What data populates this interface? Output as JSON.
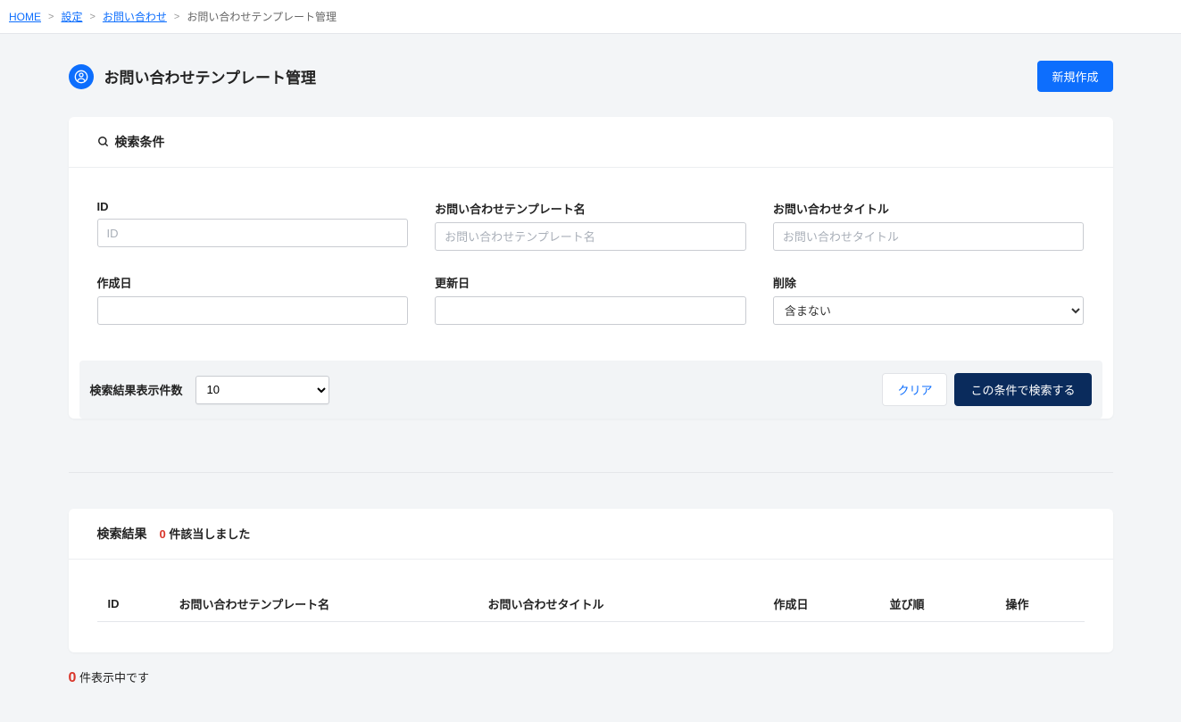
{
  "breadcrumb": {
    "items": [
      {
        "label": "HOME",
        "link": true
      },
      {
        "label": "設定",
        "link": true
      },
      {
        "label": "お問い合わせ",
        "link": true
      },
      {
        "label": "お問い合わせテンプレート管理",
        "link": false
      }
    ]
  },
  "page": {
    "title": "お問い合わせテンプレート管理",
    "create_button": "新規作成"
  },
  "search": {
    "header": "検索条件",
    "fields": {
      "id": {
        "label": "ID",
        "placeholder": "ID",
        "value": ""
      },
      "template_name": {
        "label": "お問い合わせテンプレート名",
        "placeholder": "お問い合わせテンプレート名",
        "value": ""
      },
      "inquiry_title": {
        "label": "お問い合わせタイトル",
        "placeholder": "お問い合わせタイトル",
        "value": ""
      },
      "created_at": {
        "label": "作成日",
        "value": ""
      },
      "updated_at": {
        "label": "更新日",
        "value": ""
      },
      "deleted": {
        "label": "削除",
        "selected": "含まない",
        "options": [
          "含まない"
        ]
      }
    },
    "toolbar": {
      "per_page_label": "検索結果表示件数",
      "per_page_selected": "10",
      "per_page_options": [
        "10"
      ],
      "clear": "クリア",
      "submit": "この条件で検索する"
    }
  },
  "results": {
    "header": "検索結果",
    "count": "0",
    "count_suffix": "件該当しました",
    "columns": {
      "id": "ID",
      "template_name": "お問い合わせテンプレート名",
      "inquiry_title": "お問い合わせタイトル",
      "created_at": "作成日",
      "order": "並び順",
      "action": "操作"
    },
    "rows": []
  },
  "footer": {
    "count": "0",
    "suffix": "件表示中です"
  }
}
